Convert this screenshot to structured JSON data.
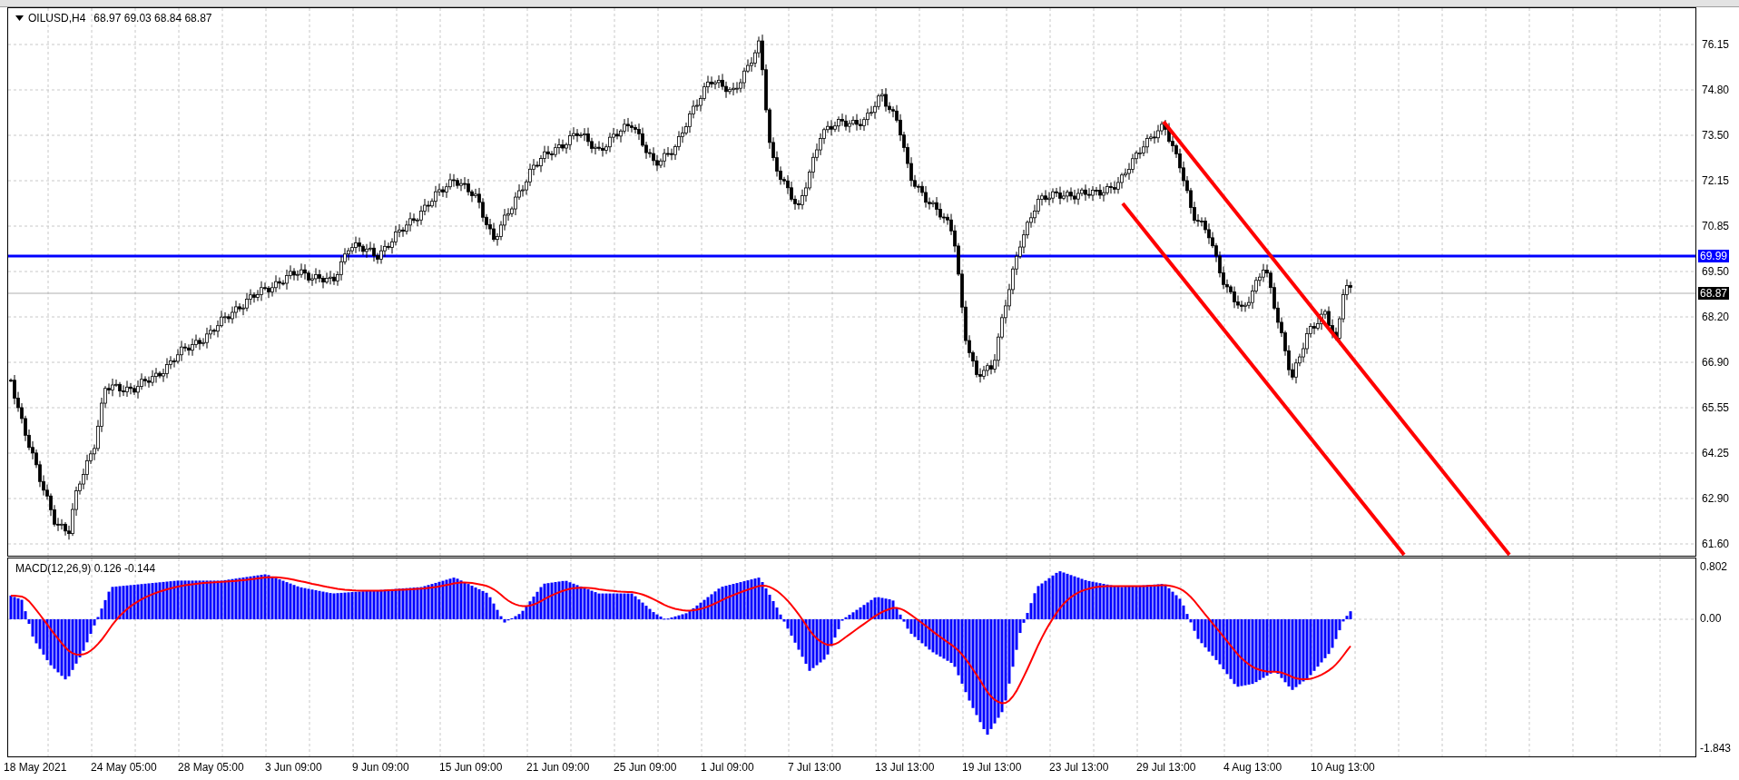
{
  "chart": {
    "symbol": "OILUSD,H4",
    "quote": "68.97 69.03 68.84 68.87",
    "price_axis": [
      "76.15",
      "74.80",
      "73.50",
      "72.15",
      "70.85",
      "69.50",
      "68.20",
      "66.90",
      "65.55",
      "64.25",
      "62.90",
      "61.60"
    ],
    "horizontal_line_label": "69.99",
    "current_price_label": "68.87"
  },
  "macd": {
    "title": "MACD(12,26,9) 0.126 -0.144",
    "axis": [
      "0.802",
      "0.00",
      "-1.843"
    ]
  },
  "time_axis": [
    "18 May 2021",
    "24 May 05:00",
    "28 May 05:00",
    "3 Jun 09:00",
    "9 Jun 09:00",
    "15 Jun 09:00",
    "21 Jun 09:00",
    "25 Jun 09:00",
    "1 Jul 09:00",
    "7 Jul 13:00",
    "13 Jul 13:00",
    "19 Jul 13:00",
    "23 Jul 13:00",
    "29 Jul 13:00",
    "4 Aug 13:00",
    "10 Aug 13:00"
  ]
}
